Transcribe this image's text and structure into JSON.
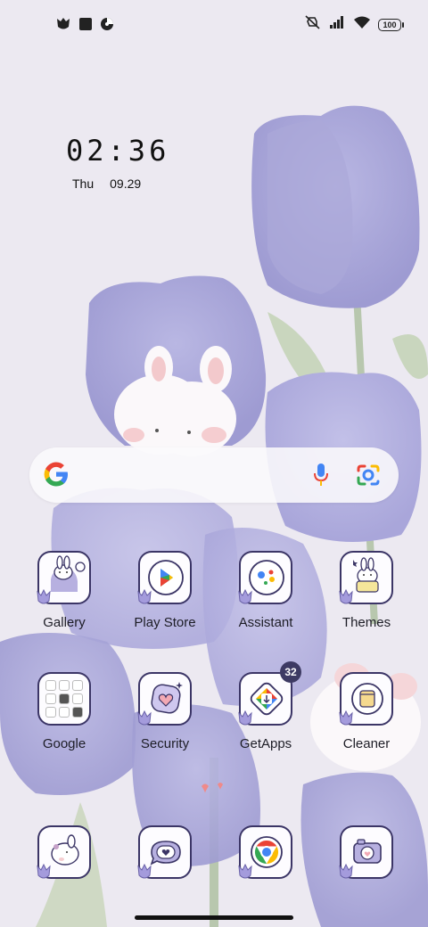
{
  "status_bar": {
    "left_icons": [
      "tulip-app-icon",
      "square-app-icon",
      "clock-app-icon"
    ],
    "right_icons": [
      "mute-vibrate-icon",
      "signal-icon",
      "wifi-icon"
    ],
    "battery": "100"
  },
  "clock": {
    "time": "02:36",
    "day": "Thu",
    "date": "09.29"
  },
  "search_bar": {
    "icons": [
      "google-g-icon",
      "microphone-icon",
      "lens-camera-icon"
    ]
  },
  "apps": [
    {
      "label": "Gallery",
      "icon": "bunny-gallery-icon"
    },
    {
      "label": "Play Store",
      "icon": "play-store-icon"
    },
    {
      "label": "Assistant",
      "icon": "assistant-icon"
    },
    {
      "label": "Themes",
      "icon": "bunny-themes-icon"
    },
    {
      "label": "Google",
      "icon": "google-folder-icon"
    },
    {
      "label": "Security",
      "icon": "security-heart-icon"
    },
    {
      "label": "GetApps",
      "icon": "getapps-icon",
      "badge": "32"
    },
    {
      "label": "Cleaner",
      "icon": "cleaner-icon"
    }
  ],
  "dock": [
    {
      "icon": "bunny-phone-icon"
    },
    {
      "icon": "messages-heart-icon"
    },
    {
      "icon": "chrome-icon"
    },
    {
      "icon": "camera-heart-icon"
    }
  ],
  "colors": {
    "tile_border": "#3b3566",
    "tulip": "#a7a5d9",
    "badge": "#3d3a63"
  }
}
